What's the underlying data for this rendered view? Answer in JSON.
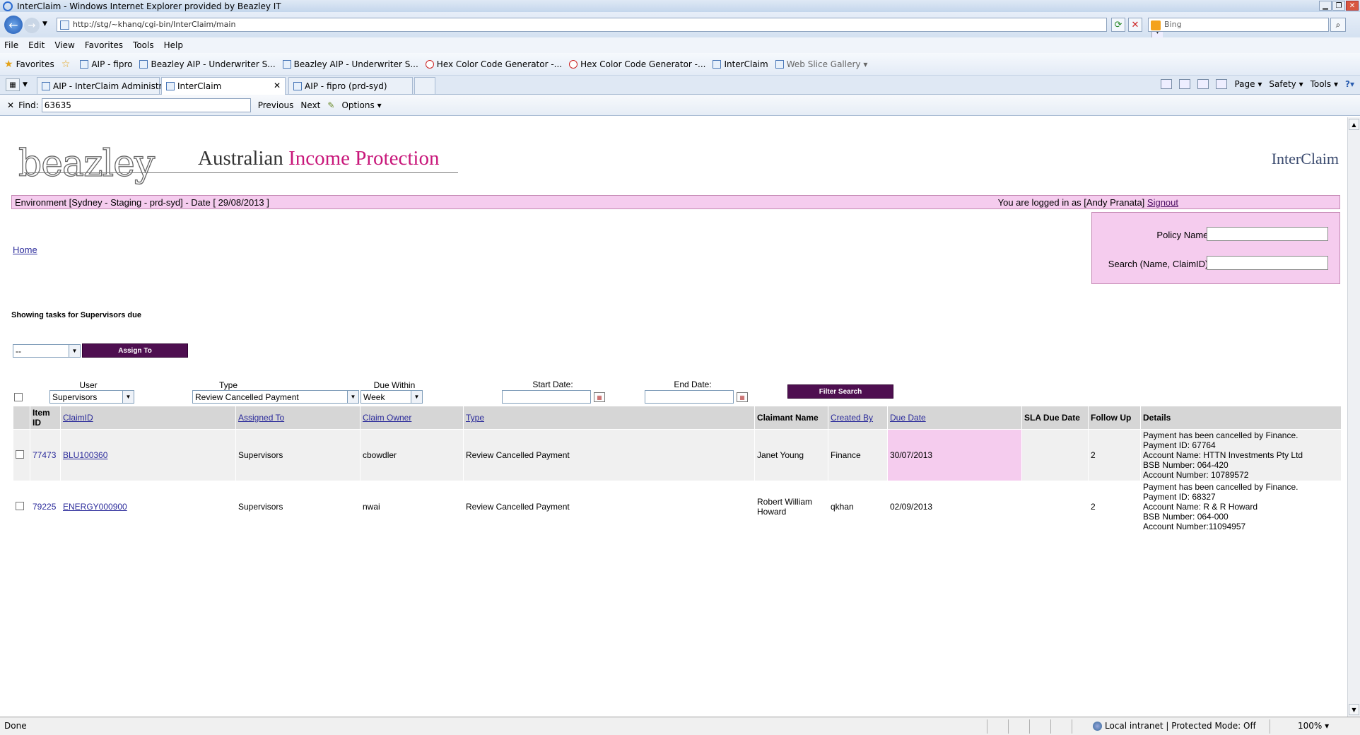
{
  "window": {
    "title": "InterClaim - Windows Internet Explorer provided by Beazley IT"
  },
  "address": {
    "url": "http://stg/~khanq/cgi-bin/InterClaim/main",
    "search_placeholder": "Bing"
  },
  "menu": [
    "File",
    "Edit",
    "View",
    "Favorites",
    "Tools",
    "Help"
  ],
  "favorites": {
    "label": "Favorites",
    "items": [
      "AIP - fipro",
      "Beazley AIP - Underwriter S...",
      "Beazley AIP - Underwriter S...",
      "Hex Color Code Generator -...",
      "Hex Color Code Generator -...",
      "InterClaim",
      "Web Slice Gallery"
    ]
  },
  "tabs": [
    "AIP - InterClaim Administration",
    "InterClaim",
    "AIP - fipro (prd-syd)"
  ],
  "toolbar_right": [
    "Page",
    "Safety",
    "Tools"
  ],
  "find": {
    "label": "Find:",
    "value": "63635",
    "previous": "Previous",
    "next": "Next",
    "options": "Options"
  },
  "header": {
    "logo_text": "beazley",
    "title_prefix": "Australian",
    "title_accent": "Income Protection",
    "app_name": "InterClaim"
  },
  "env": {
    "text": "Environment [Sydney - Staging - prd-syd] - Date [ 29/08/2013 ]",
    "logged_in": "You are logged in as [Andy Pranata]",
    "signout": "Signout"
  },
  "nav": {
    "home": "Home"
  },
  "search_panel": {
    "policy_label": "Policy Name:",
    "search_label": "Search (Name, ClaimID):"
  },
  "tasks": {
    "heading": "Showing tasks for Supervisors due",
    "assign_select": "--",
    "assign_button": "Assign To"
  },
  "filters": {
    "user_label": "User",
    "user_value": "Supervisors",
    "type_label": "Type",
    "type_value": "Review Cancelled Payment",
    "due_label": "Due Within",
    "due_value": "Week",
    "start_label": "Start Date:",
    "end_label": "End Date:",
    "filter_button": "Filter Search"
  },
  "table": {
    "headers": {
      "item_id": "Item ID",
      "claim_id": "ClaimID",
      "assigned_to": "Assigned To",
      "claim_owner": "Claim Owner",
      "type": "Type",
      "claimant_name": "Claimant Name",
      "created_by": "Created By",
      "due_date": "Due Date",
      "sla_due_date": "SLA Due Date",
      "follow_up": "Follow Up",
      "details": "Details"
    },
    "rows": [
      {
        "item_id": "77473",
        "claim_id": "BLU100360",
        "assigned_to": "Supervisors",
        "claim_owner": "cbowdler",
        "type": "Review Cancelled Payment",
        "claimant_name": "Janet Young",
        "created_by": "Finance",
        "due_date": "30/07/2013",
        "sla_due_date": "",
        "follow_up": "2",
        "details": [
          "Payment has been cancelled by Finance.",
          "Payment ID: 67764",
          "Account Name: HTTN Investments Pty Ltd",
          "BSB Number: 064-420",
          "Account Number: 10789572"
        ]
      },
      {
        "item_id": "79225",
        "claim_id": "ENERGY000900",
        "assigned_to": "Supervisors",
        "claim_owner": "nwai",
        "type": "Review Cancelled Payment",
        "claimant_name": "Robert William Howard",
        "created_by": "qkhan",
        "due_date": "02/09/2013",
        "sla_due_date": "",
        "follow_up": "2",
        "details": [
          "Payment has been cancelled by Finance.",
          "Payment ID: 68327",
          "Account Name: R & R Howard",
          "BSB Number: 064-000",
          "Account Number:11094957"
        ]
      }
    ]
  },
  "status": {
    "left": "Done",
    "zone": "Local intranet | Protected Mode: Off",
    "zoom": "100%"
  }
}
